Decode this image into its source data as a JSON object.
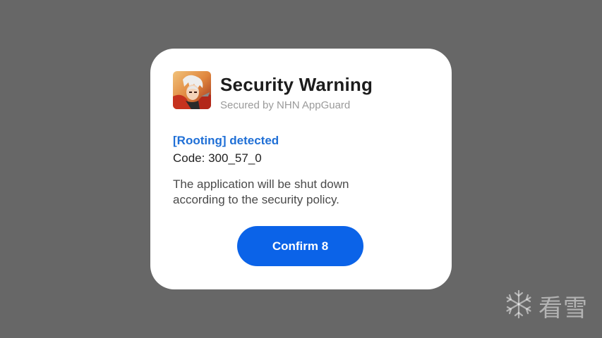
{
  "dialog": {
    "title": "Security Warning",
    "subtitle": "Secured by NHN AppGuard",
    "detected_text": "[Rooting] detected",
    "code_text": "Code: 300_57_0",
    "message": "The application will be shut down according to the security policy.",
    "confirm_label": "Confirm 8",
    "app_icon": "game-character-app-icon"
  },
  "watermark": {
    "text": "看雪",
    "icon": "snowflake-icon"
  },
  "colors": {
    "backdrop": "#676767",
    "dialog_bg": "#ffffff",
    "accent_blue": "#0b63e8",
    "link_blue": "#1f6fd6"
  }
}
